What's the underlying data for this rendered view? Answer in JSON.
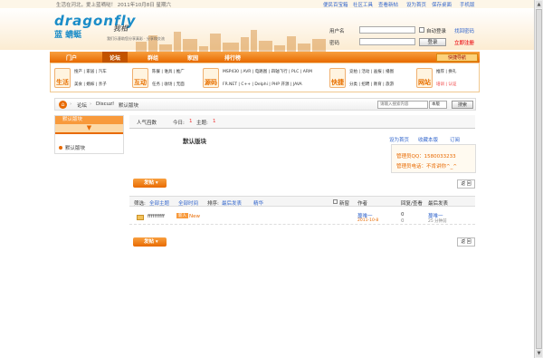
{
  "topbar": {
    "left": "生活在河北，爱上蓝嘀哒！ 2011年10月8日 星期六",
    "links": [
      "便民百宝箱",
      "社区工具",
      "查看新帖",
      "设为首页",
      "保存桌面",
      "手机版"
    ]
  },
  "brand": {
    "logo": "dragonfly",
    "logo_cn": "蓝 蜻蜓",
    "sig": "我相",
    "slogan": "我们乐意助您分享真彩 · 分享和交流"
  },
  "login": {
    "user_label": "用户名",
    "pass_label": "密码",
    "autologin": "自动登录",
    "forgot": "找回密码",
    "login_btn": "登录",
    "register": "立即注册"
  },
  "nav": {
    "items": [
      "门户",
      "论坛",
      "群组",
      "家园",
      "排行榜"
    ],
    "quick": "快捷导航"
  },
  "subnav": {
    "blocks": [
      {
        "icon": "生活",
        "lines": [
          "搜产 | 家居 | 汽车",
          "美食 | 婚嫁 | 亲子"
        ]
      },
      {
        "icon": "互动",
        "lines": [
          "陈餐 | 谁具 | 推广",
          "任务 | 收场 | 无面"
        ]
      },
      {
        "icon": "源码",
        "lines": [
          "MSP430 | AVR | 电路图 | 四轴飞行 | PLC | ARM",
          "FR.NET | C++ | Delphi | PHP 开源 | JAVA"
        ]
      },
      {
        "icon": "快捷",
        "lines": [
          "竞拍 | 活动 | 画报 | 播图",
          "分类 | 招聘 | 教育 | 旅游"
        ]
      },
      {
        "icon": "网站",
        "lines": [
          "推荐 | 换礼",
          "培训 | 认证"
        ]
      }
    ]
  },
  "breadcrumb": {
    "items": [
      "论坛",
      "Discuz!",
      "默认版块"
    ],
    "search_placeholder": "请输入搜索内容",
    "search_scope": "本版",
    "search_btn": "搜索"
  },
  "sidebar": {
    "title": "默认版块",
    "item": "默认版块"
  },
  "forum": {
    "tab_active": "人气舀数",
    "today_label": "今日:",
    "today": "1",
    "topics_label": "主题:",
    "topics": "1",
    "title": "默认版块",
    "actions": [
      "设为首页",
      "收藏本版",
      "订阅"
    ],
    "mod_qq": "管理员QQ：1580033233",
    "mod_tel": "管理员电话：不肯讲你^_^",
    "post_btn": "发帖",
    "back_btn": "返 回",
    "filter_label": "筛选:",
    "filter_all": "全部主题",
    "filter_time": "全部时间",
    "sort_label": "排序:",
    "sort_val": "最后发表",
    "hot": "精华",
    "newwin": "新窗",
    "col_author": "作者",
    "col_reply": "回复/查看",
    "col_last": "最后发表",
    "thread": {
      "title": "ffffffffff",
      "tag": "新人",
      "new": "New",
      "author": "蔓唯一",
      "date": "2011-10-8",
      "replies": "0",
      "views": "0",
      "last_author": "蔓唯一",
      "last_time": "25 分钟前"
    }
  }
}
